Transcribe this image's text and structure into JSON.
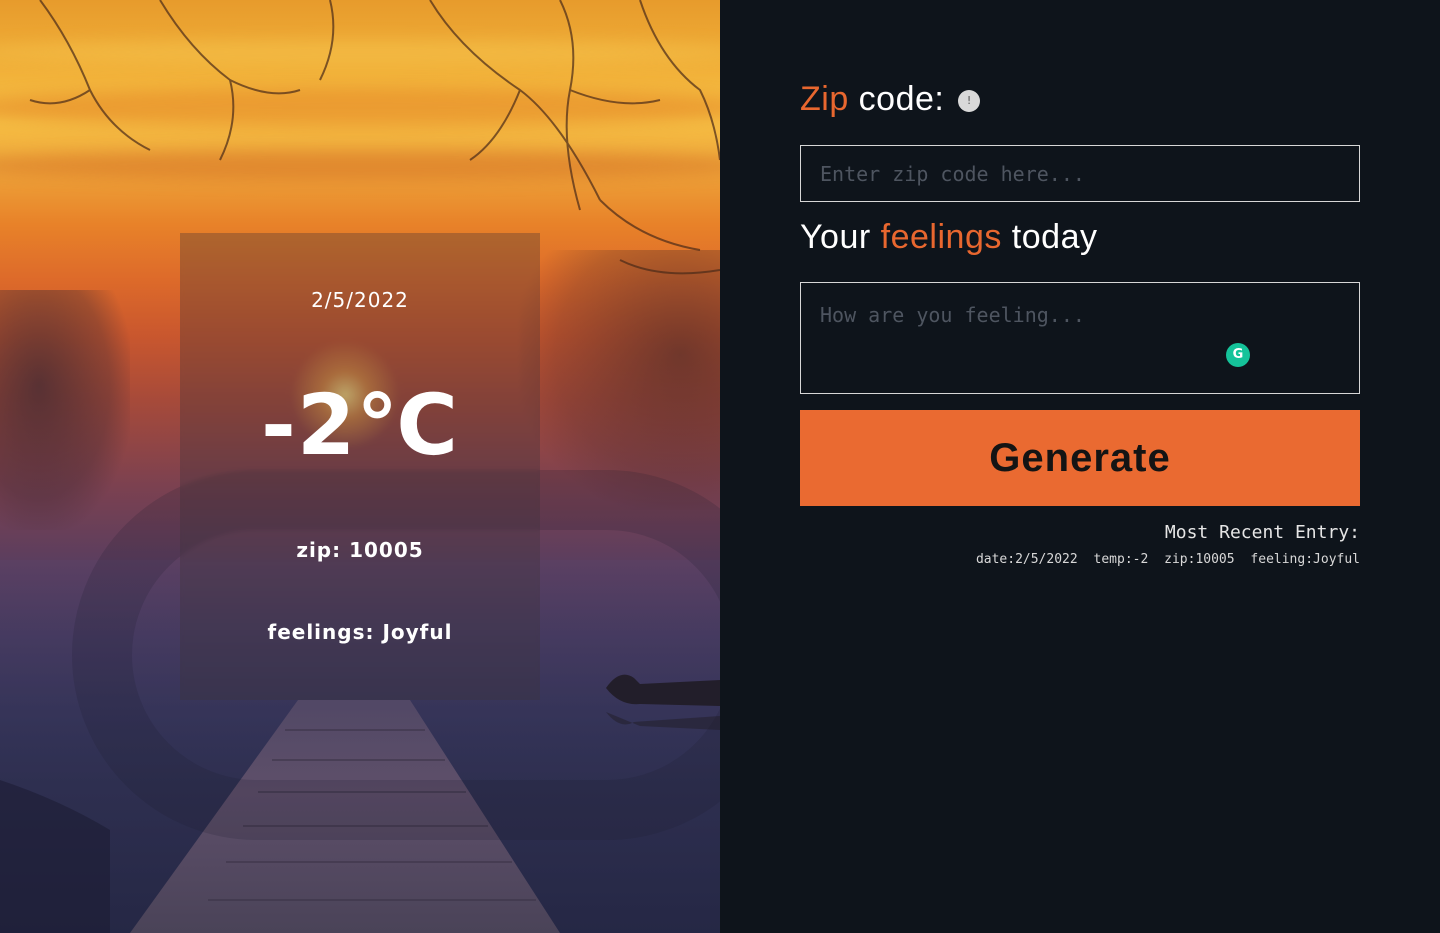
{
  "entry_card": {
    "date": "2/5/2022",
    "temp": "-2℃",
    "zip": "zip: 10005",
    "feelings": "feelings: Joyful"
  },
  "form": {
    "zip_heading": {
      "accent": "Zip",
      "rest": " code:"
    },
    "info_icon": {
      "icon": "info-icon",
      "glyph": "!"
    },
    "zip_input": {
      "value": "",
      "placeholder": "Enter zip code here..."
    },
    "feelings_heading": {
      "before": "Your ",
      "accent": "feelings",
      "after": " today"
    },
    "feelings_input": {
      "value": "",
      "placeholder": "How are you feeling..."
    },
    "grammarly": {
      "icon": "grammarly-icon",
      "glyph": "G"
    },
    "generate_label": "Generate"
  },
  "recent_entry": {
    "title": "Most Recent Entry:",
    "date": "date:2/5/2022",
    "temp": "temp:-2",
    "zip": "zip:10005",
    "feeling": "feeling:Joyful"
  },
  "colors": {
    "accent": "#e8672f",
    "button_bg": "#ea6a31",
    "panel_bg": "#0e141b",
    "grammarly_green": "#15c39a"
  }
}
